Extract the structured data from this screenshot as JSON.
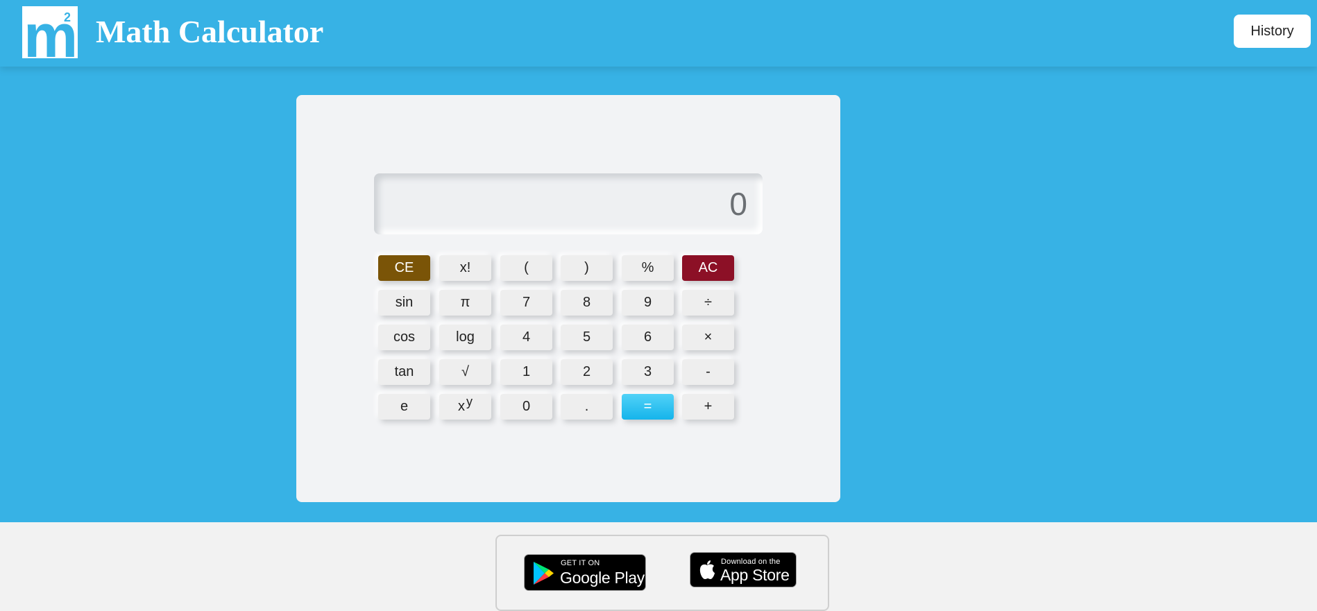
{
  "header": {
    "logo_text": "m",
    "logo_superscript": "2",
    "title": "Math Calculator",
    "history_label": "History"
  },
  "calculator": {
    "display_value": "0",
    "rows": [
      [
        "CE",
        "x!",
        "(",
        ")",
        "%",
        "AC"
      ],
      [
        "sin",
        "π",
        "7",
        "8",
        "9",
        "÷"
      ],
      [
        "cos",
        "log",
        "4",
        "5",
        "6",
        "×"
      ],
      [
        "tan",
        "√",
        "1",
        "2",
        "3",
        "-"
      ],
      [
        "e",
        "x",
        "0",
        ".",
        "=",
        "+"
      ]
    ],
    "power_superscript": "y"
  },
  "stores": {
    "google_play": {
      "small": "GET IT ON",
      "big": "Google Play"
    },
    "app_store": {
      "small": "Download on the",
      "big": "App Store"
    }
  },
  "colors": {
    "brand_blue": "#37b2e5",
    "ce_key": "#7a5407",
    "ac_key": "#8c1026",
    "equals_key": "#15b4eb"
  },
  "icons": {
    "logo": "m-squared-logo",
    "google_play": "google-play-icon",
    "app_store": "apple-icon"
  }
}
